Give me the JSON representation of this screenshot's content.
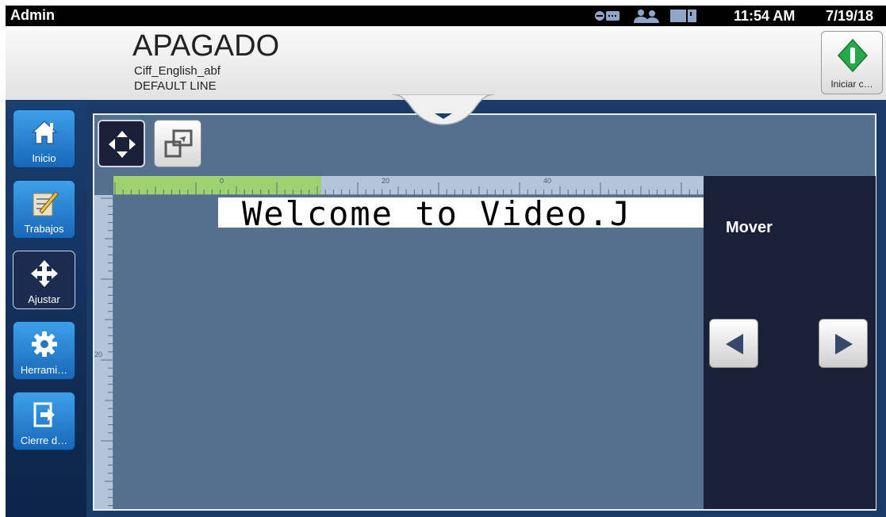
{
  "statusbar": {
    "user": "Admin",
    "time": "11:54 AM",
    "date": "7/19/18",
    "icons": [
      "network-icon",
      "users-icon",
      "ink-level-icon"
    ]
  },
  "header": {
    "state": "APAGADO",
    "job_name": "Ciff_English_abf",
    "line_name": "DEFAULT LINE",
    "start_button_label": "Iniciar c…",
    "start_button_color": "#27a84a"
  },
  "sidebar": {
    "items": [
      {
        "label": "Inicio",
        "icon": "home-icon",
        "active": false
      },
      {
        "label": "Trabajos",
        "icon": "jobs-icon",
        "active": false
      },
      {
        "label": "Ajustar",
        "icon": "move-icon",
        "active": true
      },
      {
        "label": "Herrami…",
        "icon": "gear-icon",
        "active": false
      },
      {
        "label": "Cierre d…",
        "icon": "logout-icon",
        "active": false
      }
    ]
  },
  "editor": {
    "message_text": "Welcome to Video.J",
    "ruler_h_labels": [
      "0",
      "20",
      "40"
    ],
    "ruler_v_labels": [
      "20"
    ],
    "tools": [
      "move-tool-icon",
      "resize-tool-icon"
    ]
  },
  "panel": {
    "title": "Mover"
  },
  "colors": {
    "sidebar_button": "#2d8ad8",
    "panel_bg": "#1a2038",
    "editor_bg": "#55708f",
    "ruler_active": "#9ed170"
  }
}
